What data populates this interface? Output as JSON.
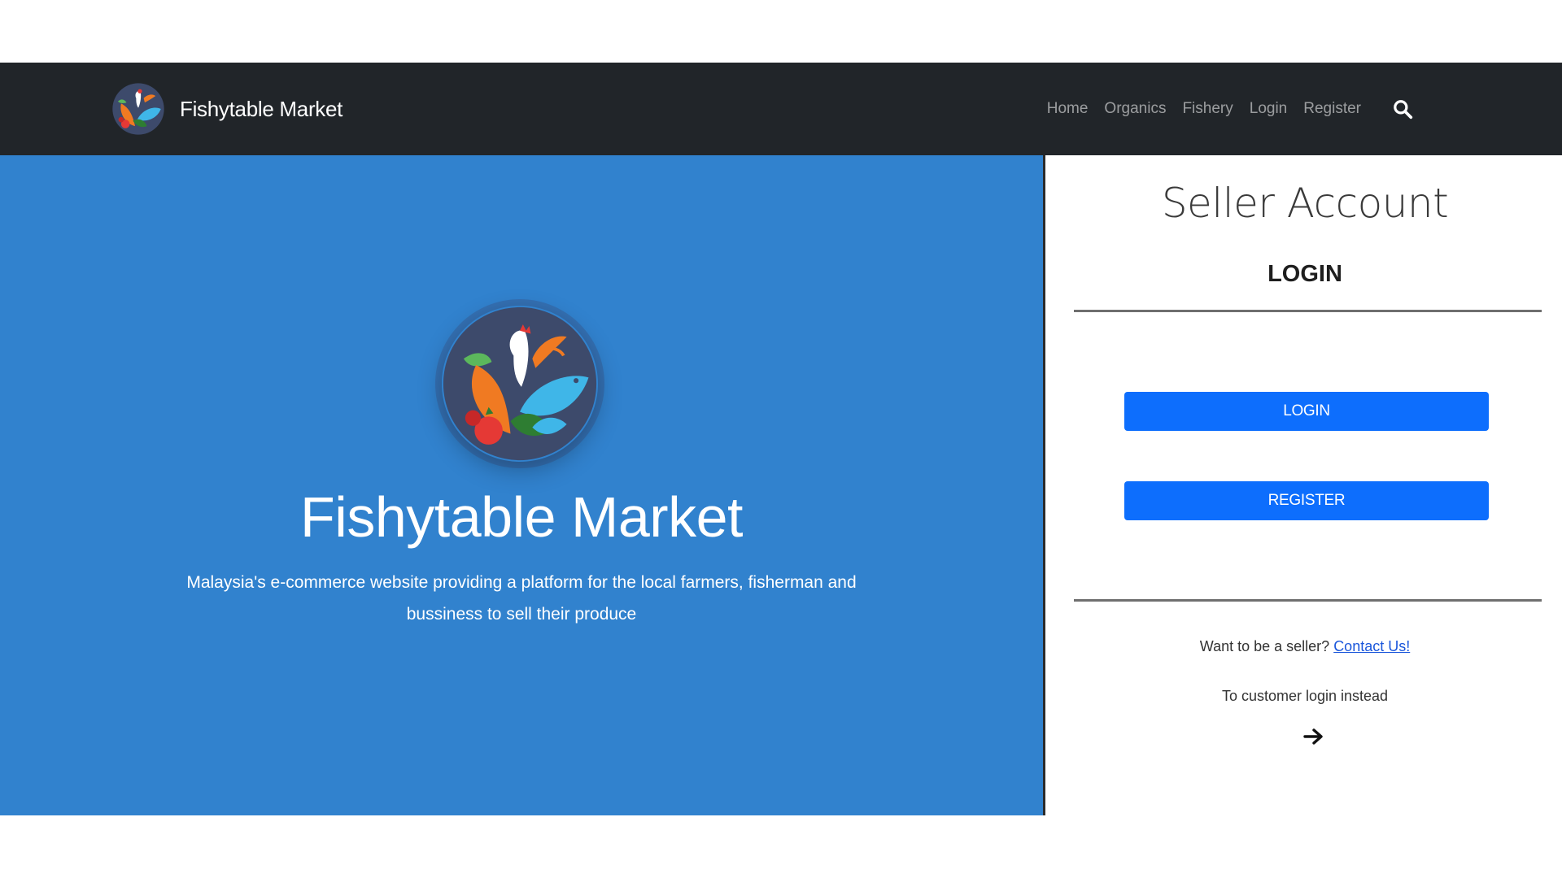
{
  "navbar": {
    "brand_name": "Fishytable Market",
    "links": [
      "Home",
      "Organics",
      "Fishery",
      "Login",
      "Register"
    ],
    "search_icon": "search-icon",
    "background_color": "#212529"
  },
  "hero": {
    "title": "Fishytable Market",
    "subtitle": "Malaysia's e-commerce website providing a platform for the local farmers, fisherman and bussiness to sell their produce",
    "background_color": "#3182ce"
  },
  "panel": {
    "title": "Seller Account",
    "subtitle": "LOGIN",
    "login_button": "LOGIN",
    "register_button": "REGISTER",
    "seller_prompt": "Want to be a seller?",
    "contact_link": "Contact Us!",
    "customer_prompt": "To customer login instead",
    "arrow_icon": "arrow-right-icon",
    "button_color": "#0d6efd"
  }
}
